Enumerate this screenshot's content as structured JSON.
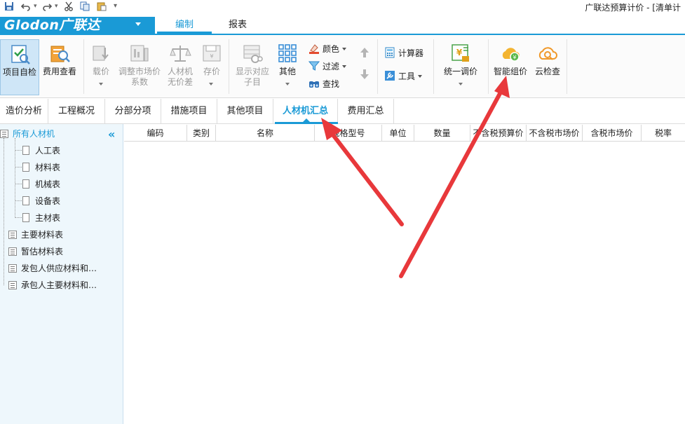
{
  "window": {
    "title": "广联达预算计价 - [清单计"
  },
  "quick_access": {
    "icons": [
      "save-icon",
      "undo-icon",
      "redo-icon",
      "cut-icon",
      "copy-icon",
      "paste-icon",
      "customize-icon"
    ]
  },
  "app": {
    "logo": "Glodon广联达"
  },
  "ribbon_tabs": [
    {
      "label": "编制"
    },
    {
      "label": "报表"
    }
  ],
  "ribbon": {
    "project_check": "项目自检",
    "cost_view": "费用查看",
    "load_price": "载价",
    "adjust_market_1": "调整市场价",
    "adjust_market_2": "系数",
    "rcj_no_diff_1": "人材机",
    "rcj_no_diff_2": "无价差",
    "save_price": "存价",
    "show_sub_1": "显示对应",
    "show_sub_2": "子目",
    "other": "其他",
    "color": "颜色",
    "filter": "过滤",
    "find": "查找",
    "calculator": "计算器",
    "tools": "工具",
    "unified_adjust": "统一调价",
    "smart_pricing": "智能组价",
    "cloud_check": "云检查"
  },
  "sub_tabs": [
    {
      "label": "造价分析"
    },
    {
      "label": "工程概况"
    },
    {
      "label": "分部分项"
    },
    {
      "label": "措施项目"
    },
    {
      "label": "其他项目"
    },
    {
      "label": "人材机汇总"
    },
    {
      "label": "费用汇总"
    }
  ],
  "tree": {
    "root": "所有人材机",
    "children": [
      "人工表",
      "材料表",
      "机械表",
      "设备表",
      "主材表"
    ],
    "others": [
      "主要材料表",
      "暂估材料表",
      "发包人供应材料和…",
      "承包人主要材料和…"
    ]
  },
  "grid": {
    "columns": [
      "编码",
      "类别",
      "名称",
      "规格型号",
      "单位",
      "数量",
      "不含税预算价",
      "不含税市场价",
      "含税市场价",
      "税率"
    ]
  },
  "colors": {
    "accent": "#1a9ad6",
    "annotation": "#e8383b",
    "tree_bg": "#eef7fc"
  }
}
